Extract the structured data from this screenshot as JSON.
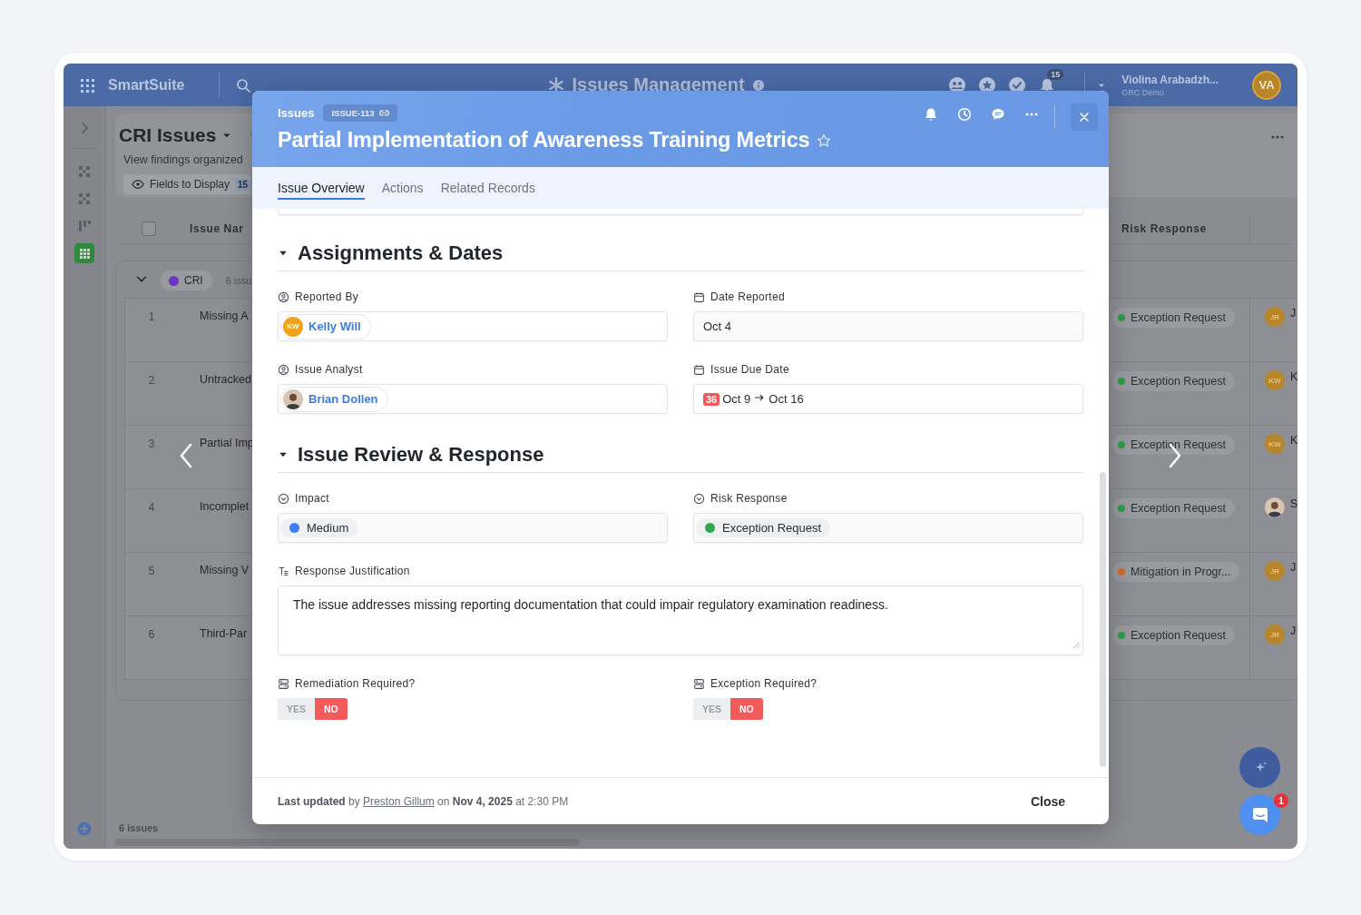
{
  "app_bar": {
    "brand": "SmartSuite",
    "title": "Issues Management",
    "notification_count": "15",
    "user": {
      "name": "Violina Arabadzh...",
      "workspace": "GRC Demo",
      "initials": "VA"
    }
  },
  "views": [
    {
      "kind": "dashboard",
      "selected": false
    },
    {
      "kind": "dashboard",
      "selected": false
    },
    {
      "kind": "kanban",
      "selected": false
    },
    {
      "kind": "grid",
      "selected": true
    }
  ],
  "page": {
    "title": "CRI Issues",
    "subtitle": "View findings organized",
    "fields_button": "Fields to Display",
    "fields_count": "15"
  },
  "table": {
    "select_all_checked": false,
    "columns": [
      "Issue Nar",
      "Risk Response"
    ],
    "group": {
      "label": "CRI",
      "color": "#6d35c0",
      "count": "6 issu",
      "expanded": true
    },
    "rows": [
      {
        "number": "1",
        "name": "Missing A",
        "risk_response": {
          "label": "Exception Request",
          "color": "#2e9e48"
        },
        "owner": {
          "kind": "initials",
          "initials": "JR",
          "name": "J"
        }
      },
      {
        "number": "2",
        "name": "Untracked",
        "risk_response": {
          "label": "Exception Request",
          "color": "#2e9e48"
        },
        "owner": {
          "kind": "initials",
          "initials": "KW",
          "name": "K"
        }
      },
      {
        "number": "3",
        "name": "Partial Imp",
        "risk_response": {
          "label": "Exception Request",
          "color": "#2e9e48"
        },
        "owner": {
          "kind": "initials",
          "initials": "KW",
          "name": "K"
        }
      },
      {
        "number": "4",
        "name": "Incomplet",
        "risk_response": {
          "label": "Exception Request",
          "color": "#2e9e48"
        },
        "owner": {
          "kind": "photo",
          "name": "S"
        }
      },
      {
        "number": "5",
        "name": "Missing V",
        "risk_response": {
          "label": "Mitigation in Progr...",
          "color": "#d9672a"
        },
        "owner": {
          "kind": "initials",
          "initials": "JR",
          "name": "J"
        }
      },
      {
        "number": "6",
        "name": "Third-Par",
        "risk_response": {
          "label": "Exception Request",
          "color": "#2e9e48"
        },
        "owner": {
          "kind": "initials",
          "initials": "JR",
          "name": "J"
        }
      }
    ],
    "footer": "6 issues"
  },
  "record": {
    "breadcrumb": "Issues",
    "record_id": "ISSUE-113",
    "title": "Partial Implementation of Awareness Training Metrics",
    "starred": false,
    "tabs": [
      {
        "label": "Issue Overview",
        "selected": true
      },
      {
        "label": "Actions",
        "selected": false
      },
      {
        "label": "Related Records",
        "selected": false
      }
    ],
    "sections": [
      {
        "title": "Assignments & Dates",
        "expanded": true,
        "fields": [
          {
            "kind": "user",
            "label": "Reported By",
            "value": {
              "kind": "initials",
              "initials": "KW",
              "name": "Kelly Will"
            }
          },
          {
            "kind": "date",
            "label": "Date Reported",
            "value": "Oct 4"
          },
          {
            "kind": "user",
            "label": "Issue Analyst",
            "value": {
              "kind": "photo",
              "name": "Brian Dollen"
            }
          },
          {
            "kind": "due_date",
            "label": "Issue Due Date",
            "overdue_days": "36",
            "start": "Oct 9",
            "end": "Oct 16"
          }
        ]
      },
      {
        "title": "Issue Review & Response",
        "expanded": true,
        "fields": [
          {
            "kind": "status",
            "label": "Impact",
            "value": "Medium",
            "color": "#3b7ff0"
          },
          {
            "kind": "status",
            "label": "Risk Response",
            "value": "Exception Request",
            "color": "#2fa84f"
          },
          {
            "kind": "text_area",
            "label": "Response Justification",
            "value": "The issue addresses missing reporting documentation that could impair regulatory examination readiness."
          },
          {
            "kind": "yes_no",
            "label": "Remediation Required?",
            "options": [
              {
                "label": "YES",
                "selected": false
              },
              {
                "label": "NO",
                "selected": true
              }
            ]
          },
          {
            "kind": "yes_no",
            "label": "Exception Required?",
            "options": [
              {
                "label": "YES",
                "selected": false
              },
              {
                "label": "NO",
                "selected": true
              }
            ]
          }
        ]
      }
    ],
    "footer": {
      "before": "**Last updated** by",
      "link": "Preston Gillum",
      "after": "on **Nov 4, 2025** at 2:30 PM",
      "close": "Close"
    }
  },
  "chat_badge": "1"
}
